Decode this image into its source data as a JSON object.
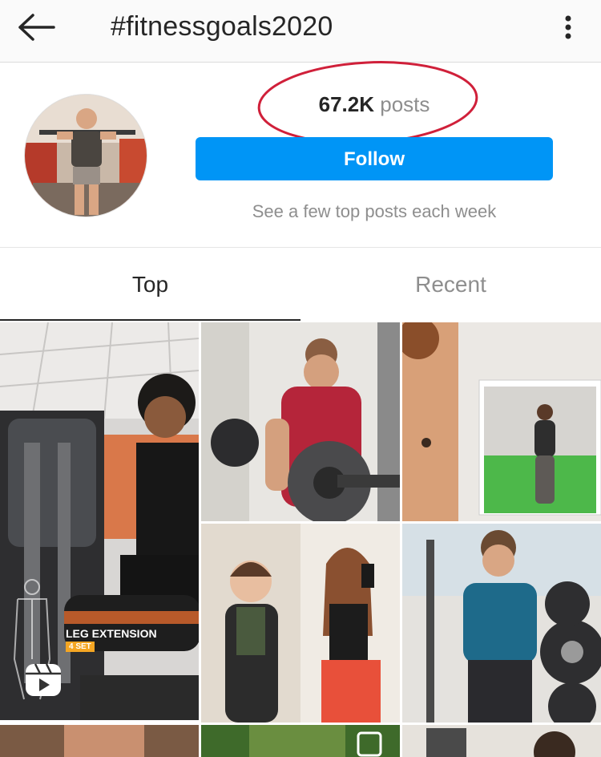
{
  "header": {
    "title": "#fitnessgoals2020",
    "back_icon": "arrow-left-icon",
    "more_icon": "more-vertical-icon"
  },
  "profile": {
    "posts_count": "67.2K",
    "posts_label": "posts",
    "follow_label": "Follow",
    "hint": "See a few top posts each week",
    "annotation_color": "#d0203a"
  },
  "tabs": {
    "top_label": "Top",
    "recent_label": "Recent"
  },
  "grid": {
    "posts": [
      {
        "id": "post-1",
        "overlay_title": "LEG EXTENSION",
        "overlay_subtitle": "4 SET",
        "reel_icon": "reels-icon"
      },
      {
        "id": "post-2"
      },
      {
        "id": "post-3"
      },
      {
        "id": "post-4"
      },
      {
        "id": "post-5"
      },
      {
        "id": "post-6"
      },
      {
        "id": "post-7"
      },
      {
        "id": "post-8"
      },
      {
        "id": "post-9"
      }
    ]
  },
  "colors": {
    "accent": "#0095f6",
    "muted_text": "#8e8e8e",
    "primary_text": "#262626"
  }
}
